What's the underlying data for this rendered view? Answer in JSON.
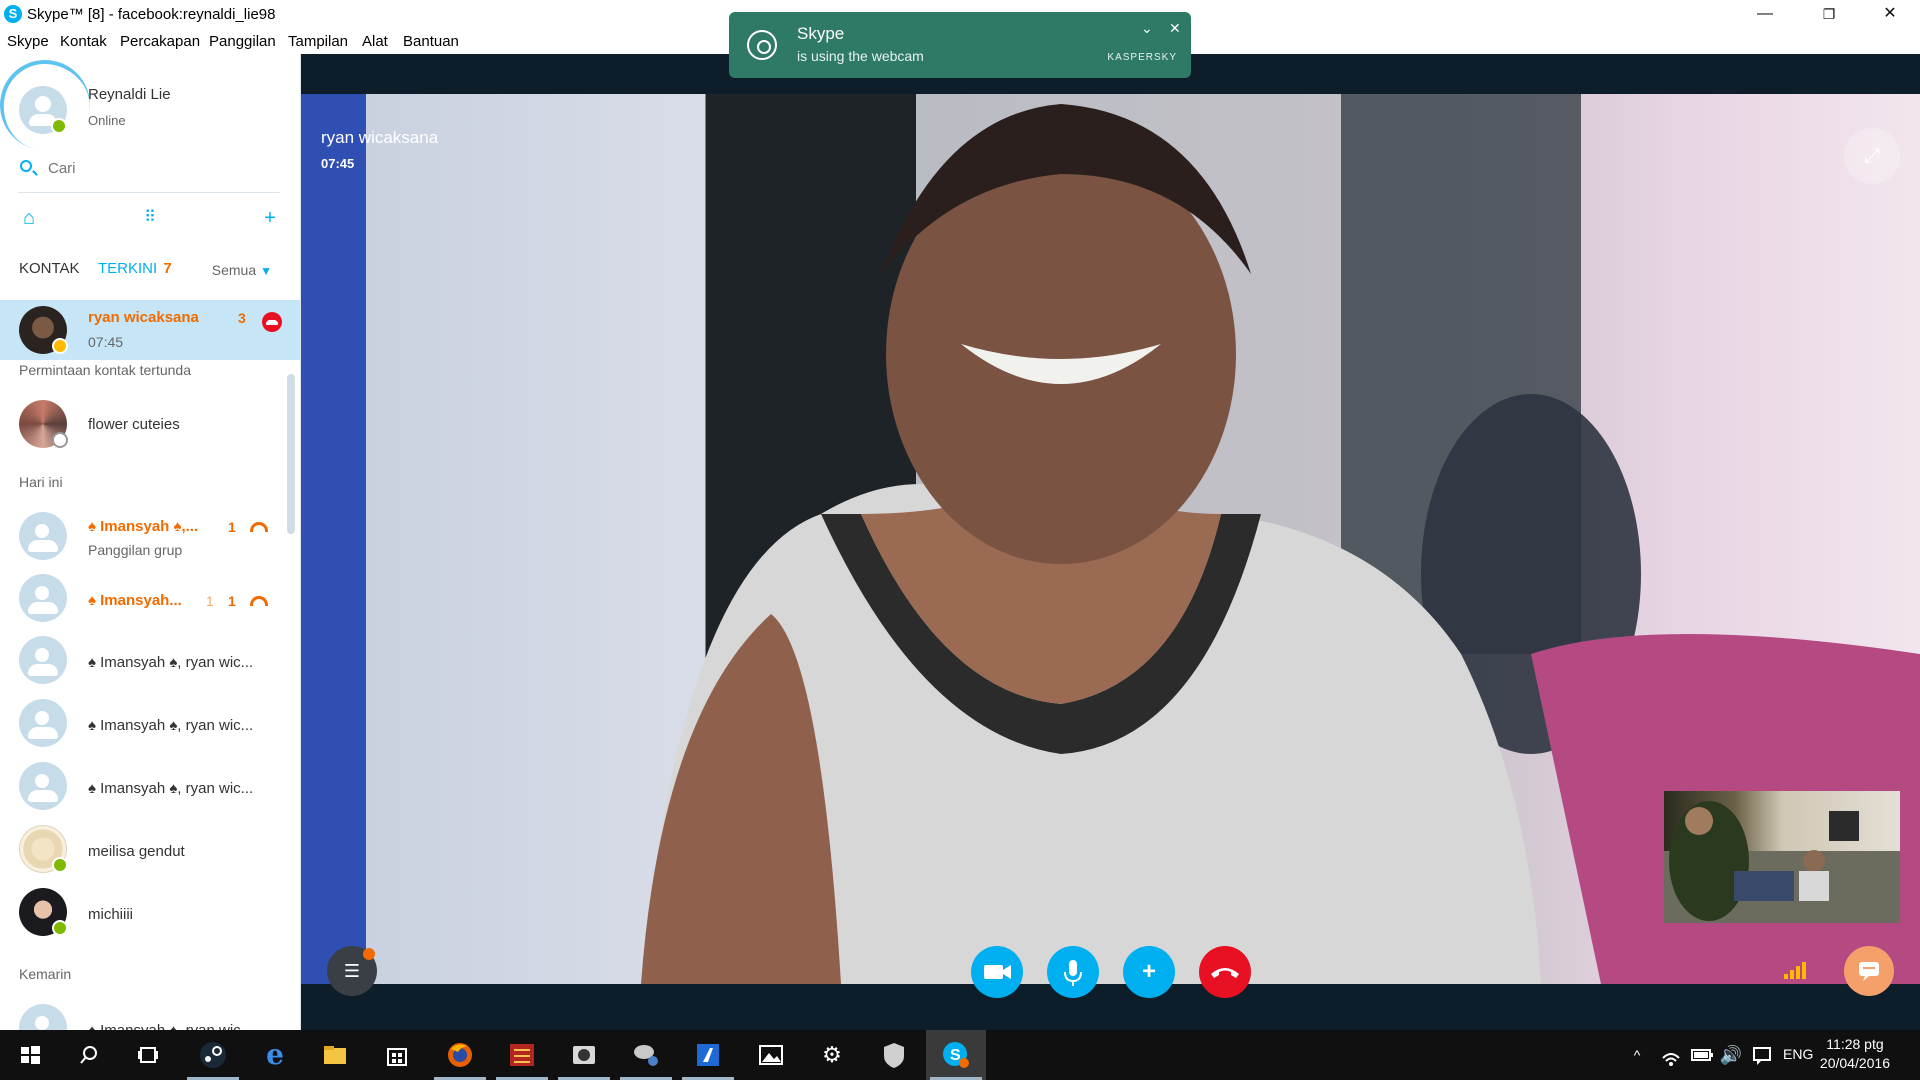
{
  "window": {
    "title": "Skype™ [8] - facebook:reynaldi_lie98",
    "minimize": "—",
    "restore": "❐",
    "close": "✕"
  },
  "menu": [
    "Skype",
    "Kontak",
    "Percakapan",
    "Panggilan",
    "Tampilan",
    "Alat",
    "Bantuan"
  ],
  "profile": {
    "name": "Reynaldi Lie",
    "status": "Online"
  },
  "search": {
    "placeholder": "Cari"
  },
  "tabs": {
    "contacts": "KONTAK",
    "recent": "TERKINI",
    "recent_count": "7",
    "filter": "Semua"
  },
  "recent": {
    "selected": {
      "name": "ryan wicaksana",
      "time": "07:45",
      "count": "3"
    },
    "pending_label": "Permintaan kontak tertunda",
    "pending": {
      "name": "flower cuteies"
    },
    "today_label": "Hari ini",
    "today": [
      {
        "name": "♠ Imansyah ♠,...",
        "sub": "Panggilan grup",
        "count": "1"
      },
      {
        "name": "♠ Imansyah...",
        "count_a": "1",
        "count_b": "1"
      },
      {
        "name": "♠ Imansyah ♠, ryan wic..."
      },
      {
        "name": "♠ Imansyah ♠, ryan wic..."
      },
      {
        "name": "♠ Imansyah ♠, ryan wic..."
      },
      {
        "name": "meilisa gendut"
      },
      {
        "name": "michiiii"
      }
    ],
    "yesterday_label": "Kemarin",
    "yesterday": [
      {
        "name": "♠ Imansyah ♠, ryan wic..."
      }
    ]
  },
  "call": {
    "caller": "ryan wicaksana",
    "duration": "07:45",
    "buttons": {
      "video": "video-camera",
      "mic": "microphone",
      "add": "+",
      "hangup": "hang-up"
    }
  },
  "toast": {
    "title": "Skype",
    "text": "is using the webcam",
    "brand": "KASPERSKY"
  },
  "taskbar": {
    "language": "ENG",
    "time": "11:28 ptg",
    "date": "20/04/2016"
  },
  "colors": {
    "accent": "#00aff0",
    "missed": "#f26b00",
    "hangup": "#e81123",
    "online": "#7fba00",
    "toast": "#2e7a66"
  }
}
